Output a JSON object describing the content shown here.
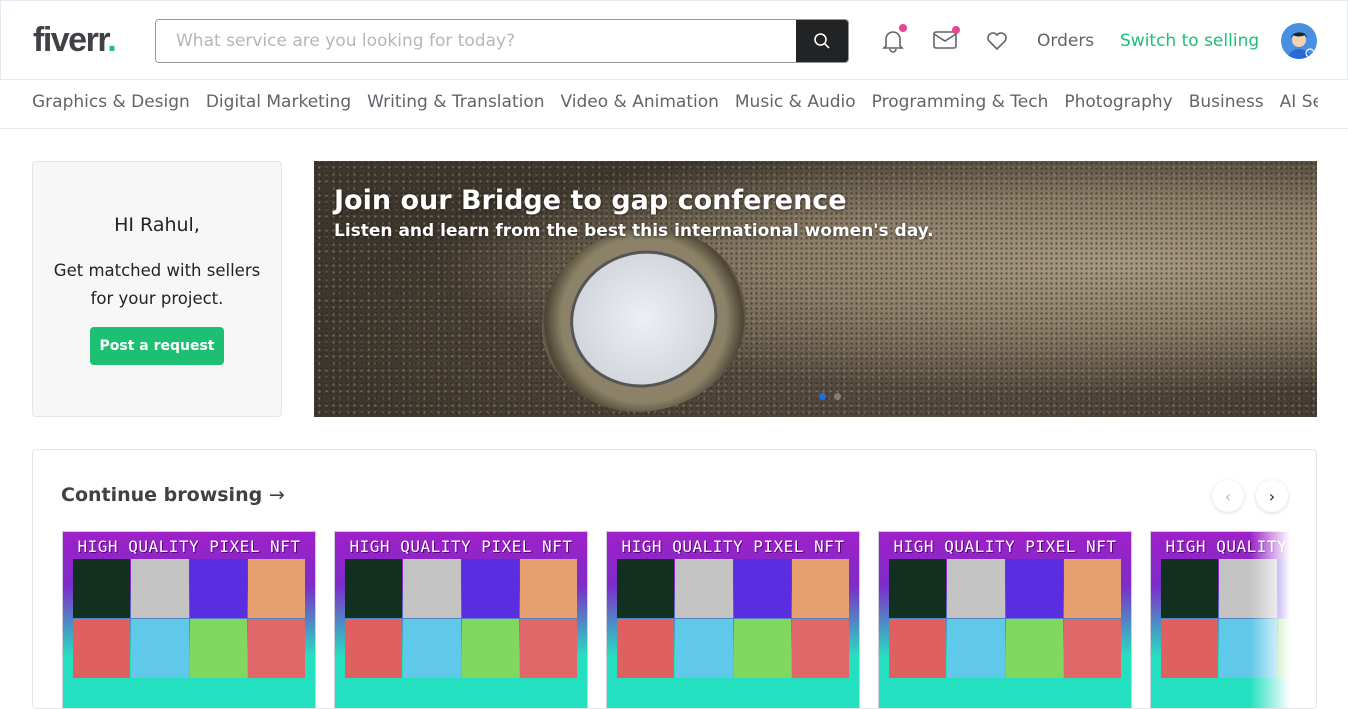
{
  "header": {
    "logo": "fiverr",
    "logo_dot": ".",
    "search_placeholder": "What service are you looking for today?",
    "orders": "Orders",
    "switch": "Switch to selling",
    "brand_color": "#1dbf73",
    "badge_color": "#e6478c"
  },
  "categories": [
    "Graphics & Design",
    "Digital Marketing",
    "Writing & Translation",
    "Video & Animation",
    "Music & Audio",
    "Programming & Tech",
    "Photography",
    "Business",
    "AI Services"
  ],
  "welcome": {
    "greeting": "HI Rahul,",
    "text": "Get matched with sellers for your project.",
    "button": "Post a request"
  },
  "banner": {
    "title": "Join our Bridge to gap conference",
    "subtitle": "Listen and learn from the best this international women's day.",
    "active_slide": 1
  },
  "browse": {
    "title": "Continue browsing",
    "arrow": "→",
    "prev": "‹",
    "next": "›",
    "cards": [
      {
        "title": "HIGH QUALITY PIXEL NFT"
      },
      {
        "title": "HIGH QUALITY PIXEL NFT"
      },
      {
        "title": "HIGH QUALITY PIXEL NFT"
      },
      {
        "title": "HIGH QUALITY PIXEL NFT"
      },
      {
        "title": "HIGH QUALITY PIXEL NFT"
      }
    ]
  }
}
